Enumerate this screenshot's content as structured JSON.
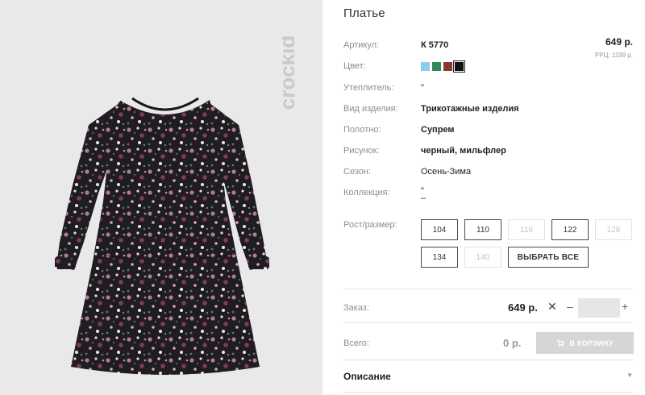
{
  "brand": {
    "name": "crockid"
  },
  "product": {
    "title": "Платье",
    "price": "649 р.",
    "rrp": "РРЦ: 1199 р."
  },
  "specs": [
    {
      "label": "Артикул:",
      "value": "К 5770"
    },
    {
      "label": "Цвет:",
      "value": ""
    },
    {
      "label": "Утеплитель:",
      "value": "\""
    },
    {
      "label": "Вид изделия:",
      "value": "Трикотажные изделия"
    },
    {
      "label": "Полотно:",
      "value": "Супрем"
    },
    {
      "label": "Рисунок:",
      "value": "черный, мильфлер"
    },
    {
      "label": "Сезон:",
      "value": "Осень-Зима"
    },
    {
      "label": "Коллекция:",
      "value": "\"",
      "value2": "–"
    }
  ],
  "swatches": [
    {
      "color": "#8ecbef",
      "selected": false
    },
    {
      "color": "#2e8b57",
      "selected": false
    },
    {
      "color": "#8a3a2a",
      "selected": false
    },
    {
      "color": "#111111",
      "selected": true
    }
  ],
  "sizes": {
    "label": "Рост/размер:",
    "items": [
      {
        "label": "104",
        "available": true
      },
      {
        "label": "110",
        "available": true
      },
      {
        "label": "116",
        "available": false
      },
      {
        "label": "122",
        "available": true
      },
      {
        "label": "128",
        "available": false
      },
      {
        "label": "134",
        "available": true
      },
      {
        "label": "140",
        "available": false
      }
    ],
    "select_all": "ВЫБРАТЬ ВСЕ"
  },
  "order": {
    "label": "Заказ:",
    "price": "649 р.",
    "times": "✕",
    "minus": "–",
    "plus": "+",
    "qty": ""
  },
  "total": {
    "label": "Всего:",
    "value": "0 р.",
    "cart_button": "В КОРЗИНУ"
  },
  "description": {
    "label": "Описание"
  },
  "icons": [
    "cart-icon",
    "chevron-down-icon",
    "close-icon"
  ]
}
